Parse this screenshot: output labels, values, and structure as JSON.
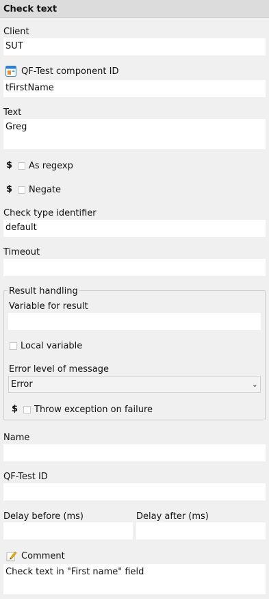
{
  "header": {
    "title": "Check text"
  },
  "client": {
    "label": "Client",
    "value": "SUT"
  },
  "component": {
    "label": "QF-Test component ID",
    "value": "tFirstName",
    "icon": "component-window-icon"
  },
  "text": {
    "label": "Text",
    "value": "Greg"
  },
  "as_regexp": {
    "label": "As regexp",
    "checked": false
  },
  "negate": {
    "label": "Negate",
    "checked": false
  },
  "dollar_symbol": "$",
  "check_type": {
    "label": "Check type identifier",
    "value": "default"
  },
  "timeout": {
    "label": "Timeout",
    "value": ""
  },
  "result_handling": {
    "title": "Result handling",
    "variable_label": "Variable for result",
    "variable_value": "",
    "local_variable_label": "Local variable",
    "error_level_label": "Error level of message",
    "error_level_value": "Error",
    "throw_label": "Throw exception on failure"
  },
  "name": {
    "label": "Name",
    "value": ""
  },
  "qftest_id": {
    "label": "QF-Test ID",
    "value": ""
  },
  "delay_before": {
    "label": "Delay before (ms)",
    "value": ""
  },
  "delay_after": {
    "label": "Delay after (ms)",
    "value": ""
  },
  "comment": {
    "label": "Comment",
    "value": "Check text in \"First name\" field",
    "icon": "pencil-note-icon"
  }
}
